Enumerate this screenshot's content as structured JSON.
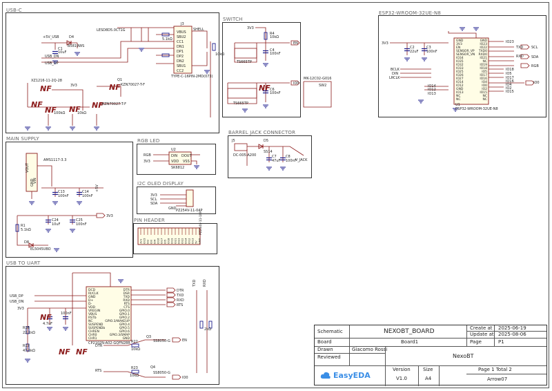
{
  "blocks": {
    "usbc": "USB-C",
    "switch": "SWITCH",
    "esp32": "ESP32-WROOM-32UE-N8",
    "main_supply": "MAIN SUPPLY",
    "rgb_led": "RGB LED",
    "barrel": "BARREL JACK CONNECTOR",
    "oled": "I2C OLED DISPLAY",
    "pin_header": "PIN HEADER",
    "usb_uart": "USB TO UART"
  },
  "labels": {
    "usbc": {
      "plus5v_usb": "+5V_USB",
      "d4": "D4",
      "d4_part": "B5819WS",
      "c1": "C1",
      "c1_val": "10uF",
      "usb_dn": "USB_DN",
      "usb_dp": "USB_DP",
      "gnd": "GND",
      "led_part": "LESD8D5.0CT1G",
      "j3": "J3",
      "shell": "SHELL",
      "vbus": "VBUS",
      "sbu2": "SBU2",
      "cc1": "CC1",
      "dn1": "DN1",
      "dp1": "DP1",
      "dp2": "DP2",
      "dn2": "DN2",
      "sbu1": "SBU1",
      "cc2": "CC2",
      "r_5k1": "5.1kΩ",
      "j3_part": "TYPE-C-16PIN-2MD(073)",
      "r_10k": "10kΩ",
      "q1": "Q1",
      "q1_part": "XZ1216-11-2Q-28",
      "q2": "Q2",
      "q2_part": "KZN70027-T-F",
      "q2b": "Q2",
      "q2b_part": "KZN70027-T-F",
      "v3v3": "3V3",
      "r_100k": "100kΩ",
      "r_10k2": "10kΩ"
    },
    "switch": {
      "v3v3": "3V3",
      "r4": "R4",
      "r4_val": "10kΩ",
      "en": "EN",
      "c4": "C4",
      "c4_val": "100nF",
      "ts1": "TS665TP",
      "ts2": "TS665TP",
      "io0": "IO0",
      "c6": "C6",
      "c6_val": "100nF",
      "sw2": "SW2",
      "sw2_part": "MK-12C02-G016",
      "gnd": "GND"
    },
    "esp32": {
      "v3v3": "3V3",
      "c2": "C2",
      "c2_val": "22uF",
      "c3": "C3",
      "c3_val": "100nF",
      "gnd": "GND",
      "left_pins": [
        "GND",
        "3V3",
        "EN",
        "SENSOR_VP",
        "SENSOR_VN",
        "IO34",
        "IO35",
        "IO32",
        "IO33",
        "IO25",
        "IO26",
        "IO27",
        "IO14",
        "IO12",
        "GND",
        "IO13",
        "NC",
        "NC"
      ],
      "right_pins": [
        "GND",
        "IO23",
        "IO22",
        "TXD0",
        "RXD0",
        "IO21",
        "NC",
        "IO19",
        "IO18",
        "IO5",
        "IO17",
        "IO16",
        "IO4",
        "IO0",
        "IO2",
        "IO15",
        "NC",
        "NC"
      ],
      "left_nets": [
        "BCLK",
        "DIN",
        "LRCLK",
        "IO14",
        "IO12",
        "IO13"
      ],
      "right_nets": [
        "IO23",
        "SCL",
        "TXD",
        "RXD",
        "SDA",
        "RGB",
        "IO18",
        "IO5",
        "IO17",
        "IO16",
        "IO4",
        "IO2",
        "IO15",
        "IO0"
      ],
      "u1": "U1",
      "u1_part": "ESP32-WROOM-32UE-N8"
    },
    "main_supply": {
      "ams": "AMS1117-3.3",
      "vin": "VIN",
      "vout": "VOUT",
      "gnd": "GND",
      "c13": "C13",
      "c13_val": "100nF",
      "c14": "C14",
      "c14_val": "100nF",
      "plus5v": "+5V",
      "c24": "C24",
      "c24_val": "10uF",
      "c25": "C25",
      "c25_val": "100nF",
      "v3v3": "3V3",
      "r1": "R1",
      "r1_val": "5.1kΩ",
      "d8": "D8",
      "d8_part": "EL5045UBO"
    },
    "rgb": {
      "rgb": "RGB",
      "v3v3": "3V3",
      "u2": "U2",
      "din": "DIN",
      "vdd": "VDD",
      "dout": "DOUT",
      "vss": "VSS",
      "part": "SK6812",
      "gnd": "GND"
    },
    "barrel": {
      "j5": "J5",
      "d5": "D5",
      "d5_part": "SS14",
      "part": "DC-005-A200",
      "c7": "C7",
      "c7_val": "47uF",
      "c8": "C8",
      "c8_val": "100nF",
      "vjack": "V_JACK",
      "gnd": "GND"
    },
    "oled": {
      "v3v3": "3V3",
      "scl": "SCL",
      "sda": "SDA",
      "gnd": "GND",
      "part": "PZ254V-11-04P"
    },
    "header": {
      "part": "PZ254V-11-18P",
      "pins": [
        "3V3",
        "IO15",
        "IO2",
        "IO0",
        "IO4",
        "IO16",
        "IO17",
        "IO5",
        "IO18",
        "IO19",
        "IO21",
        "IO23",
        "IO22",
        "IO14",
        "IO12",
        "IO13",
        "5V",
        "GND"
      ]
    },
    "uart": {
      "usb_dp": "USB_DP",
      "usb_dn": "USB_DN",
      "v3v3": "3V3",
      "c_val1": "4.7uF",
      "c4_val": "100nF",
      "left_pins": [
        "DCD",
        "RI/CLK",
        "GND",
        "D+",
        "D-",
        "VDD",
        "VREGIN",
        "VBUS",
        "RSTb",
        "NC",
        "SUSPEND",
        "SUSPENDb",
        "CHREN",
        "CHR0",
        "CHR1"
      ],
      "right_pins": [
        "DTR",
        "DSR",
        "TXD",
        "RXD",
        "RTS",
        "CTS",
        "GPIO.0",
        "GPIO.1",
        "GPIO.2",
        "GPIO.3/WAKEUP",
        "GPIO.4",
        "GPIO.5",
        "GPIO.6",
        "GPIO.3/SMAP",
        "GND"
      ],
      "out_nets": [
        "DTR",
        "TXD",
        "RXD",
        "RTS"
      ],
      "u3_part": "CP2102N-A02-GQFN28R",
      "r16": "R16",
      "r16_val": "22.1kΩ",
      "r17": "R17",
      "r17_val": "47.5kΩ",
      "q3": "Q3",
      "q3_part": "SS8050-G",
      "q4": "Q4",
      "q4_part": "SS8050-G",
      "r22": "R22",
      "r22_val": "10kΩ",
      "r23": "R23",
      "r23_val": "10kΩ",
      "en": "EN",
      "io0": "IO0",
      "dtr": "DTR",
      "rts": "RTS",
      "txd": "TXD",
      "rxd": "RXD",
      "r_2k": "2kΩ"
    }
  },
  "titleblock": {
    "schematic_label": "Schematic",
    "title": "NEXOBT_BOARD",
    "create_label": "Create at",
    "create_date": "2025-06-19",
    "update_label": "Update at",
    "update_date": "2025-08-06",
    "board_label": "Board",
    "board_value": "Board1",
    "page_label": "Page",
    "page_value": "P1",
    "drawn_label": "Drawn",
    "drawn_value": "Giacomo Rossi",
    "reviewed_label": "Reviewed",
    "project": "NexoBT",
    "version_label": "Version",
    "version_value": "V1.0",
    "size_label": "Size",
    "size_value": "A4",
    "pages": "Page  1  Total  2",
    "author": "Arrow07",
    "brand": "EasyEDA"
  },
  "colors": {
    "wire": "#8b1a1a",
    "part": "#1a1a8b",
    "text": "#222222",
    "net": "#8b1a1a",
    "gnd": "#1a1a8b"
  }
}
